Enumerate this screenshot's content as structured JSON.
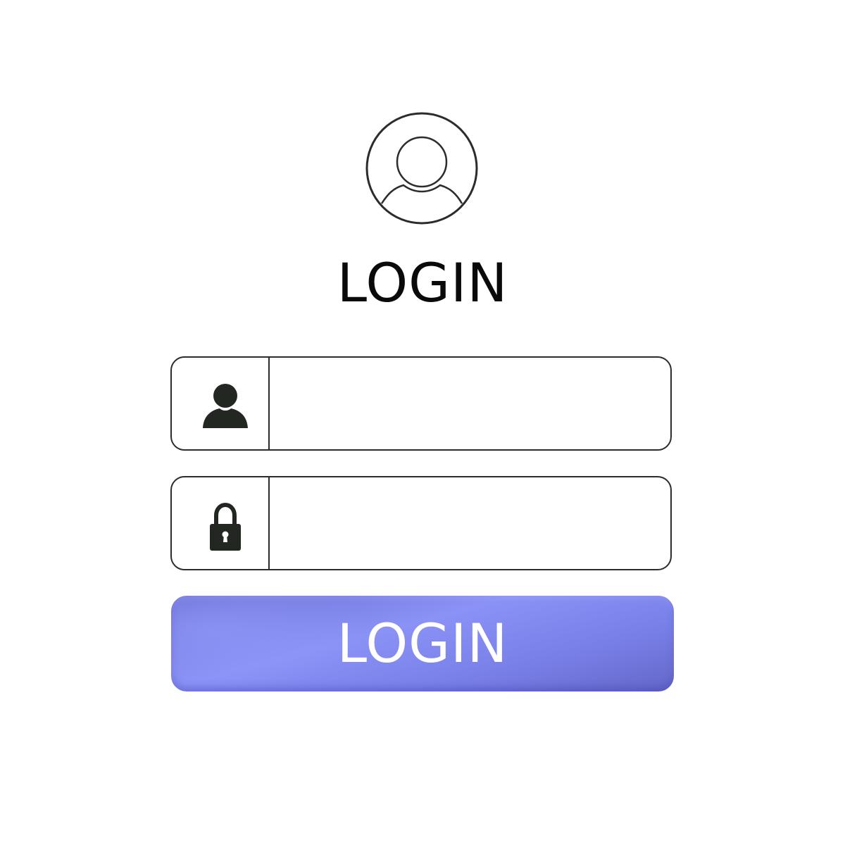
{
  "form": {
    "title": "LOGIN",
    "username": {
      "icon": "user-icon",
      "value": "",
      "placeholder": ""
    },
    "password": {
      "icon": "lock-icon",
      "value": "",
      "placeholder": ""
    },
    "submit_label": "LOGIN",
    "avatar_icon": "avatar-icon"
  },
  "colors": {
    "button": "#8a92f6",
    "button_dark": "#6467c9",
    "outline": "#2a2d2a",
    "text": "#0a0a0a",
    "background": "#ffffff"
  }
}
